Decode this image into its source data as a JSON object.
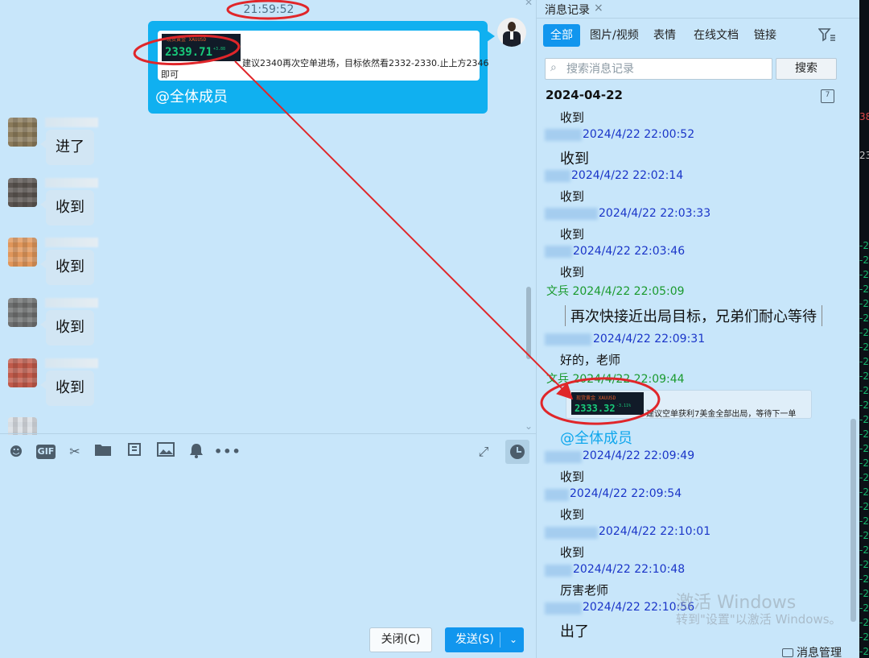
{
  "chat": {
    "timestamp": "21:59:52",
    "my_message": {
      "quote": {
        "ticker_name": "现货黄金 XAUUSD",
        "price": "2339.71",
        "change": "+3.88",
        "text_line1": "建议2340再次空单进场，目标依然看2332-2330.止上方2346",
        "text_line2": "即可"
      },
      "mention": "@全体成员"
    },
    "messages": [
      {
        "text": "进了"
      },
      {
        "text": "收到"
      },
      {
        "text": "收到"
      },
      {
        "text": "收到"
      },
      {
        "text": "收到"
      }
    ],
    "toolbar": {
      "gif": "GIF",
      "more": "•••"
    },
    "close_label": "关闭(C)",
    "send_label": "发送(S)"
  },
  "history": {
    "tab_label": "消息记录",
    "filters": [
      "全部",
      "图片/视频",
      "表情",
      "在线文档",
      "链接"
    ],
    "search_placeholder": "搜索消息记录",
    "search_button": "搜索",
    "date_header": "2024-04-22",
    "calendar_day": "7",
    "records": [
      {
        "time": "",
        "text": "收到"
      },
      {
        "time": "2024/4/22 22:00:52",
        "text": "收到"
      },
      {
        "time": "2024/4/22 22:02:14",
        "text": "收到"
      },
      {
        "time": "2024/4/22 22:03:33",
        "text": "收到"
      },
      {
        "time": "2024/4/22 22:03:46",
        "text": "收到"
      },
      {
        "time": "文兵 2024/4/22 22:05:09",
        "text": "再次快接近出局目标，兄弟们耐心等待"
      },
      {
        "time": "2024/4/22 22:09:31",
        "text": "好的，老师"
      },
      {
        "time": "文兵 2024/4/22 22:09:44",
        "text": "@全体成员"
      },
      {
        "time": "2024/4/22 22:09:49",
        "text": "收到"
      },
      {
        "time": "2024/4/22 22:09:54",
        "text": "收到"
      },
      {
        "time": "2024/4/22 22:10:01",
        "text": "收到"
      },
      {
        "time": "2024/4/22 22:10:48",
        "text": "厉害老师"
      },
      {
        "time": "2024/4/22 22:10:56",
        "text": "出了"
      }
    ],
    "quote2": {
      "ticker_name": "现货黄金 XAUUSD",
      "price": "2333.32",
      "change": "-3.11%",
      "text": "建议空单获利7美金全部出局，等待下一单"
    },
    "manage_label": "消息管理"
  },
  "watermark": {
    "line1": "激活 Windows",
    "line2": "转到\"设置\"以激活 Windows。"
  },
  "edge_ticks": [
    "38",
    "23",
    "-2",
    "-2",
    "-2",
    "-2",
    "-2",
    "-2",
    "-2",
    "-2",
    "-2",
    "-2",
    "-2",
    "-2",
    "-2",
    "-2",
    "-2",
    "-2",
    "-2",
    "-2",
    "-2",
    "-2",
    "-2",
    "-2",
    "-2",
    "-2",
    "-2",
    "-2",
    "-2",
    "-2",
    "-2"
  ],
  "colors": {
    "background": "#c8e6fa",
    "accent": "#1196ee",
    "my_bubble": "#10b0f0",
    "annotation": "#e0262a"
  }
}
